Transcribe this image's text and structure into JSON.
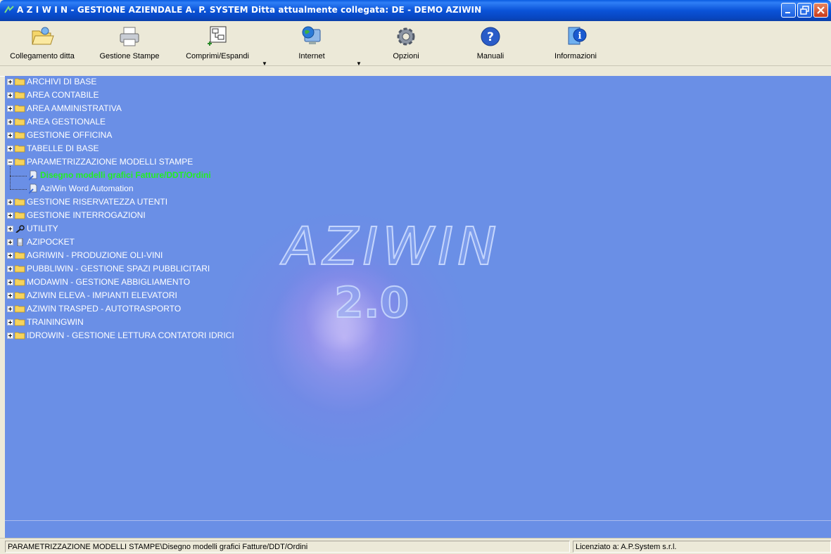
{
  "window": {
    "title": "A Z I W I N - GESTIONE AZIENDALE A. P. SYSTEM   Ditta attualmente collegata: DE - DEMO AZIWIN",
    "controls": [
      "minimize-icon",
      "restore-icon",
      "close-icon"
    ]
  },
  "toolbar": {
    "items": [
      {
        "label": "Collegamento ditta",
        "icon": "folder-open-icon"
      },
      {
        "label": "Gestione Stampe",
        "icon": "printer-icon"
      },
      {
        "label": "Comprimi/Espandi",
        "icon": "tree-toggle-icon",
        "dropdown": true
      },
      {
        "label": "Internet",
        "icon": "globe-monitor-icon",
        "dropdown": true
      },
      {
        "label": "Opzioni",
        "icon": "gear-icon"
      },
      {
        "label": "Manuali",
        "icon": "help-icon"
      },
      {
        "label": "Informazioni",
        "icon": "info-icon"
      }
    ]
  },
  "tree": {
    "items": [
      {
        "label": "ARCHIVI DI BASE",
        "icon": "folder-icon",
        "expanded": false
      },
      {
        "label": "AREA CONTABILE",
        "icon": "folder-icon",
        "expanded": false
      },
      {
        "label": "AREA AMMINISTRATIVA",
        "icon": "folder-icon",
        "expanded": false
      },
      {
        "label": "AREA GESTIONALE",
        "icon": "folder-icon",
        "expanded": false
      },
      {
        "label": "GESTIONE OFFICINA",
        "icon": "folder-icon",
        "expanded": false
      },
      {
        "label": "TABELLE DI BASE",
        "icon": "folder-icon",
        "expanded": false
      },
      {
        "label": "PARAMETRIZZAZIONE MODELLI STAMPE",
        "icon": "folder-icon",
        "expanded": true,
        "children": [
          {
            "label": "Disegno modelli grafici Fatture/DDT/Ordini",
            "icon": "document-icon",
            "selected": true
          },
          {
            "label": "AziWin Word Automation",
            "icon": "document-icon",
            "selected": false
          }
        ]
      },
      {
        "label": "GESTIONE RISERVATEZZA UTENTI",
        "icon": "folder-icon",
        "expanded": false
      },
      {
        "label": "GESTIONE INTERROGAZIONI",
        "icon": "folder-icon",
        "expanded": false
      },
      {
        "label": "UTILITY",
        "icon": "tools-icon",
        "expanded": false
      },
      {
        "label": "AZIPOCKET",
        "icon": "pda-icon",
        "expanded": false
      },
      {
        "label": "AGRIWIN - PRODUZIONE OLI-VINI",
        "icon": "folder-icon",
        "expanded": false
      },
      {
        "label": "PUBBLIWIN - GESTIONE SPAZI PUBBLICITARI",
        "icon": "folder-icon",
        "expanded": false
      },
      {
        "label": "MODAWIN - GESTIONE ABBIGLIAMENTO",
        "icon": "folder-icon",
        "expanded": false
      },
      {
        "label": "AZIWIN ELEVA - IMPIANTI ELEVATORI",
        "icon": "folder-icon",
        "expanded": false
      },
      {
        "label": "AZIWIN TRASPED - AUTOTRASPORTO",
        "icon": "folder-icon",
        "expanded": false
      },
      {
        "label": "TRAININGWIN",
        "icon": "folder-icon",
        "expanded": false
      },
      {
        "label": "IDROWIN - GESTIONE LETTURA CONTATORI IDRICI",
        "icon": "folder-icon",
        "expanded": false
      }
    ]
  },
  "watermark": {
    "logo": "AZIWIN",
    "version": "2.0"
  },
  "statusbar": {
    "path": "PARAMETRIZZAZIONE MODELLI STAMPE\\Disegno modelli grafici Fatture/DDT/Ordini",
    "license": "Licenziato a: A.P.System s.r.l."
  },
  "colors": {
    "tree_background": "#6a8fe6",
    "selected_text": "#22ee22",
    "title_bar": "#0a53d8"
  }
}
